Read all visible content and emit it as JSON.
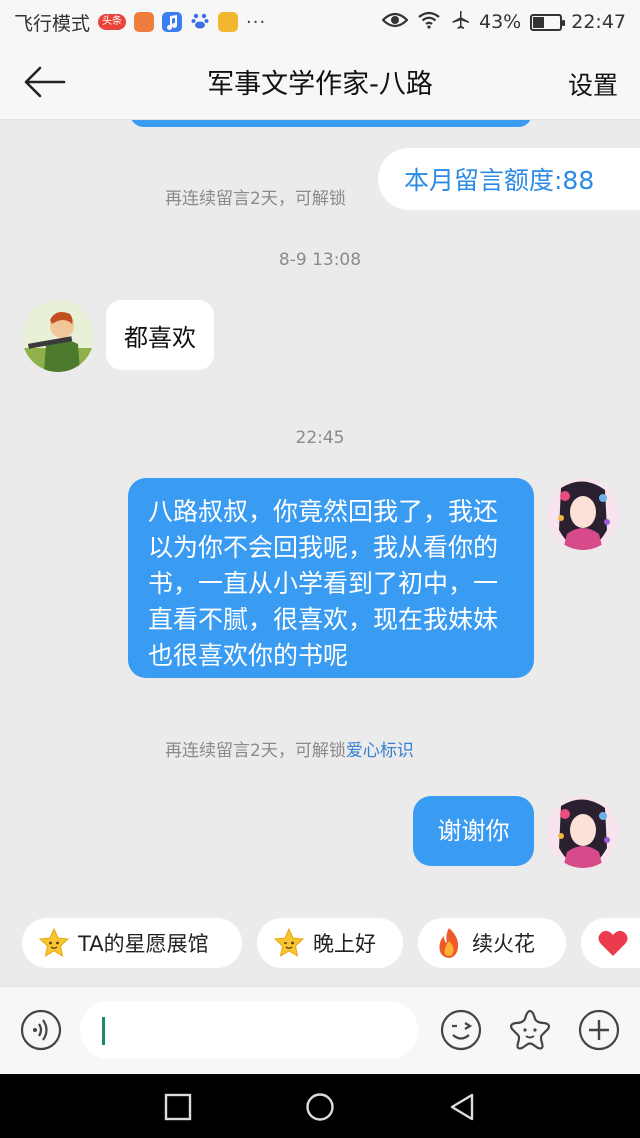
{
  "status_bar": {
    "airplane_label": "飞行模式",
    "badge_text": "头条",
    "battery_percent": "43%",
    "battery_level": 0.43,
    "time": "22:47",
    "icons": [
      "eye-icon",
      "wifi-icon",
      "airplane-icon",
      "battery-icon"
    ]
  },
  "header": {
    "back_icon": "arrow-left-icon",
    "title": "军事文学作家-八路",
    "settings_label": "设置"
  },
  "chat": {
    "hint_top_prefix": "再连续留言2天，可解锁",
    "quota_label": "本月留言额度:88",
    "timestamp_1": "8-9 13:08",
    "incoming_message": "都喜欢",
    "timestamp_2": "22:45",
    "outgoing_message_1": "八路叔叔，你竟然回我了，我还以为你不会回我呢，我从看你的书，一直从小学看到了初中，一直看不腻，很喜欢，现在我妹妹也很喜欢你的书呢",
    "hint_bottom_prefix": "再连续留言2天，可解锁",
    "hint_bottom_link": "爱心标识",
    "outgoing_message_2": "谢谢你"
  },
  "quick_replies": [
    {
      "label": "TA的星愿展馆",
      "icon": "star-face-icon"
    },
    {
      "label": "晚上好",
      "icon": "star-wink-icon"
    },
    {
      "label": "续火花",
      "icon": "fire-icon"
    },
    {
      "label": "",
      "icon": "heart-icon"
    }
  ],
  "input_bar": {
    "voice_icon": "voice-icon",
    "emoji_icon": "emoji-icon",
    "sticker_icon": "star-sticker-icon",
    "plus_icon": "plus-icon",
    "input_value": ""
  },
  "nav_bar": {
    "icons": [
      "recents-square-icon",
      "home-circle-icon",
      "back-triangle-icon"
    ]
  },
  "colors": {
    "accent": "#3a9bf2",
    "background": "#ebebeb",
    "link": "#3a7fd0"
  }
}
